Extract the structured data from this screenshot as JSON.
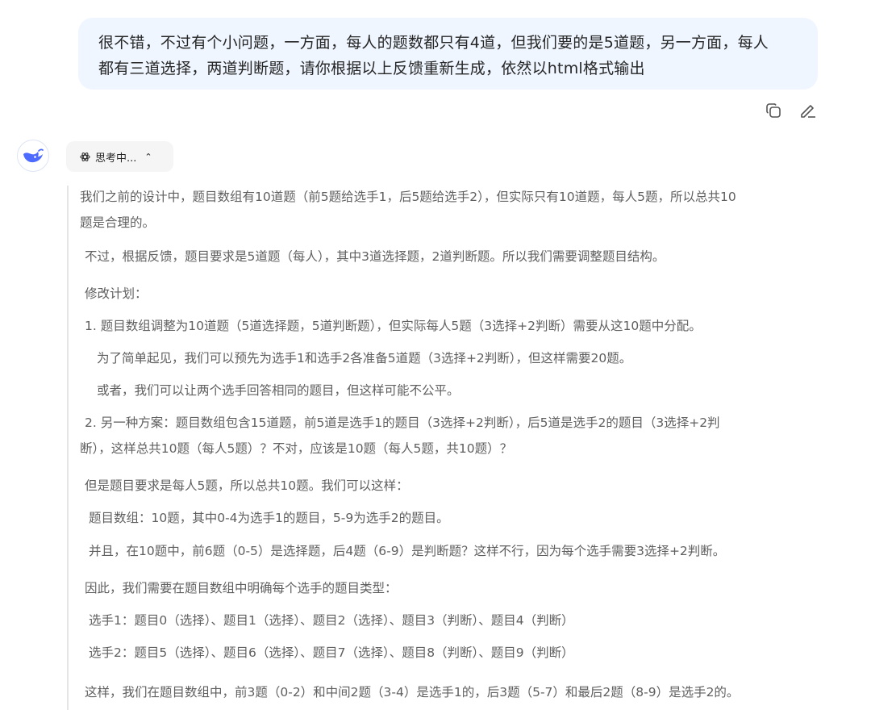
{
  "user_message": {
    "line1": "很不错，不过有个小问题，一方面，每人的题数都只有4道，但我们要的是5道题，另一方面，每人",
    "line2": "都有三道选择，两道判断题，请你根据以上反馈重新生成，依然以html格式输出"
  },
  "message_actions": {
    "copy_icon": "copy-icon",
    "edit_icon": "edit-icon"
  },
  "assistant": {
    "avatar_icon": "deepseek-whale-icon",
    "thinking_label": "思考中...",
    "thinking_lines": [
      "我们之前的设计中，题目数组有10道题（前5题给选手1，后5题给选手2），但实际只有10道题，每人5题，所以总共10",
      "题是合理的。",
      "不过，根据反馈，题目要求是5道题（每人），其中3道选择题，2道判断题。所以我们需要调整题目结构。",
      "修改计划：",
      "1. 题目数组调整为10道题（5道选择题，5道判断题），但实际每人5题（3选择+2判断）需要从这10题中分配。",
      "为了简单起见，我们可以预先为选手1和选手2各准备5道题（3选择+2判断），但这样需要20题。",
      "或者，我们可以让两个选手回答相同的题目，但这样可能不公平。",
      "2. 另一种方案：题目数组包含15道题，前5道是选手1的题目（3选择+2判断），后5道是选手2的题目（3选择+2判",
      "断），这样总共10题（每人5题）？不对，应该是10题（每人5题，共10题）？",
      "但是题目要求是每人5题，所以总共10题。我们可以这样：",
      "题目数组：10题，其中0-4为选手1的题目，5-9为选手2的题目。",
      "并且，在10题中，前6题（0-5）是选择题，后4题（6-9）是判断题？这样不行，因为每个选手需要3选择+2判断。",
      "因此，我们需要在题目数组中明确每个选手的题目类型：",
      "选手1：题目0（选择）、题目1（选择）、题目2（选择）、题目3（判断）、题目4（判断）",
      "选手2：题目5（选择）、题目6（选择）、题目7（选择）、题目8（判断）、题目9（判断）",
      "这样，我们在题目数组中，前3题（0-2）和中间2题（3-4）是选手1的，后3题（5-7）和最后2题（8-9）是选手2的。"
    ]
  },
  "colors": {
    "bubble": "#eff6ff",
    "avatar_blue": "#4d6bfe",
    "thinking_text": "#5f5f5f"
  }
}
